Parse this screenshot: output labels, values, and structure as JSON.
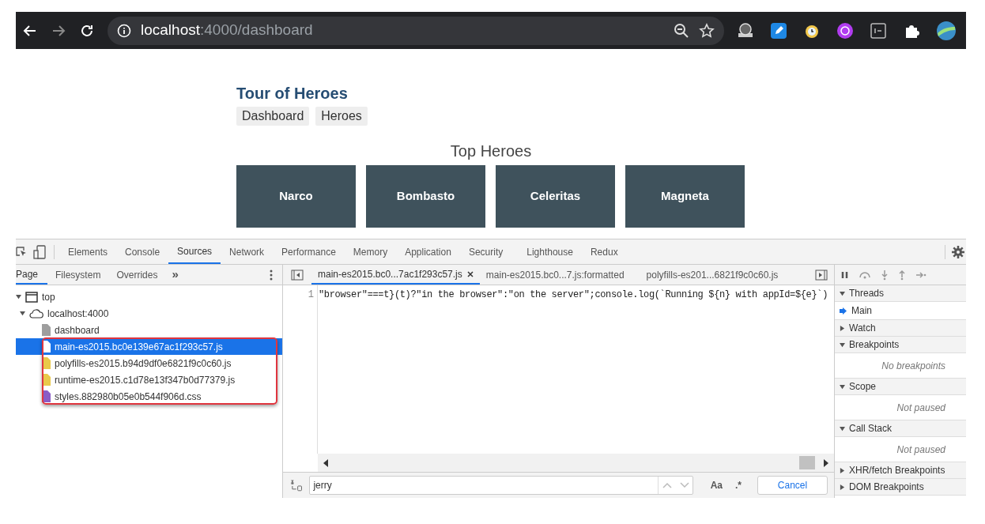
{
  "browser": {
    "url_host": "localhost",
    "url_rest": ":4000/dashboard"
  },
  "app": {
    "title": "Tour of Heroes",
    "nav": [
      "Dashboard",
      "Heroes"
    ],
    "heading": "Top Heroes",
    "heroes": [
      "Narco",
      "Bombasto",
      "Celeritas",
      "Magneta"
    ]
  },
  "devtools": {
    "tabs": [
      {
        "label": "Elements",
        "selected": false
      },
      {
        "label": "Console",
        "selected": false
      },
      {
        "label": "Sources",
        "selected": true
      },
      {
        "label": "Network",
        "selected": false
      },
      {
        "label": "Performance",
        "selected": false
      },
      {
        "label": "Memory",
        "selected": false
      },
      {
        "label": "Application",
        "selected": false
      },
      {
        "label": "Security",
        "selected": false
      },
      {
        "label": "Lighthouse",
        "selected": false
      },
      {
        "label": "Redux",
        "selected": false
      }
    ],
    "navigator_tabs": [
      {
        "label": "Page",
        "selected": true
      },
      {
        "label": "Filesystem",
        "selected": false
      },
      {
        "label": "Overrides",
        "selected": false
      }
    ],
    "more": "»",
    "tree": [
      {
        "label": "top",
        "kind": "frame",
        "expanded": true,
        "children": [
          {
            "label": "localhost:4000",
            "kind": "origin",
            "expanded": true,
            "children": [
              {
                "label": "dashboard",
                "kind": "document",
                "selected": false
              },
              {
                "label": "main-es2015.bc0e139e67ac1f293c57.js",
                "kind": "script",
                "selected": true
              },
              {
                "label": "polyfills-es2015.b94d9df0e6821f9c0c60.js",
                "kind": "script",
                "selected": false
              },
              {
                "label": "runtime-es2015.c1d78e13f347b0d77379.js",
                "kind": "script",
                "selected": false
              },
              {
                "label": "styles.882980b05e0b544f906d.css",
                "kind": "stylesheet",
                "selected": false
              }
            ]
          }
        ]
      }
    ],
    "editor_tabs": [
      {
        "label": "main-es2015.bc0...7ac1f293c57.js",
        "selected": true,
        "closable": true
      },
      {
        "label": "main-es2015.bc0...7.js:formatted",
        "selected": false,
        "closable": false
      },
      {
        "label": "polyfills-es201...6821f9c0c60.js",
        "selected": false,
        "closable": false
      }
    ],
    "code_lines": [
      {
        "number": "1",
        "text": "\"browser\"===t}(t)?\"in the browser\":\"on the server\";console.log(`Running ${n} with appId=${e}`)"
      }
    ],
    "sections": [
      {
        "title": "Threads",
        "expanded": true,
        "kind": "threads",
        "items": [
          "Main"
        ]
      },
      {
        "title": "Watch",
        "expanded": false
      },
      {
        "title": "Breakpoints",
        "expanded": true,
        "kind": "note",
        "items": [
          "No breakpoints"
        ]
      },
      {
        "title": "Scope",
        "expanded": true,
        "kind": "note",
        "items": [
          "Not paused"
        ]
      },
      {
        "title": "Call Stack",
        "expanded": true,
        "kind": "note",
        "items": [
          "Not paused"
        ]
      },
      {
        "title": "XHR/fetch Breakpoints",
        "expanded": false
      },
      {
        "title": "DOM Breakpoints",
        "expanded": false
      }
    ],
    "search": {
      "value": "jerry",
      "match_case": "Aa",
      "regex": ".*",
      "cancel": "Cancel"
    }
  }
}
